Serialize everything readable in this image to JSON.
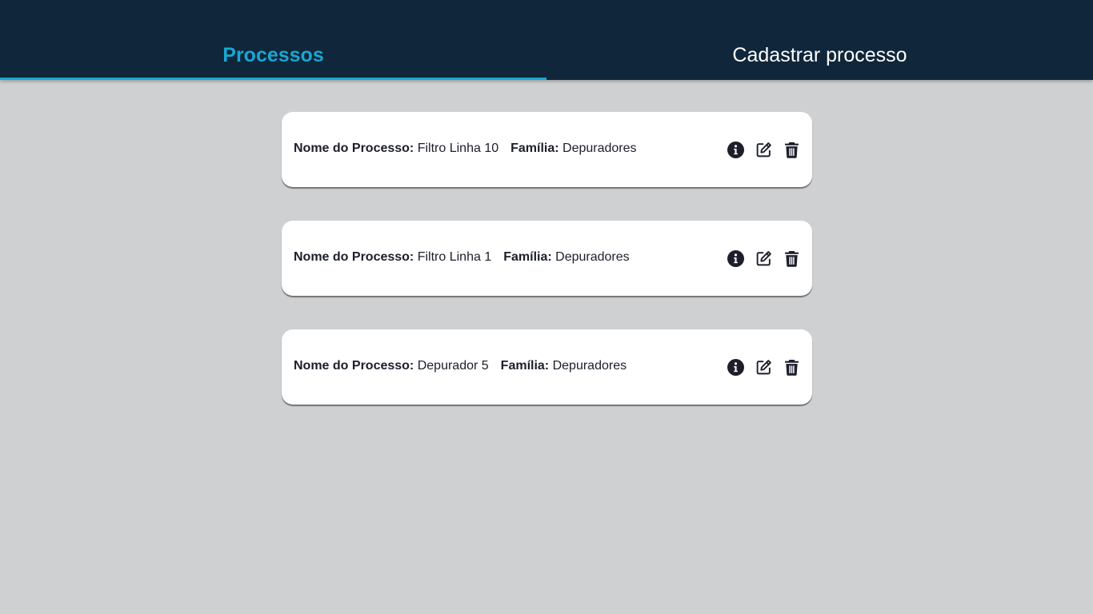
{
  "tabs": [
    {
      "label": "Processos",
      "active": true
    },
    {
      "label": "Cadastrar processo",
      "active": false
    }
  ],
  "labels": {
    "process_name": "Nome do Processo:",
    "family": "Família:"
  },
  "processes": [
    {
      "name": "Filtro Linha 10",
      "family": "Depuradores"
    },
    {
      "name": "Filtro Linha 1",
      "family": "Depuradores"
    },
    {
      "name": "Depurador 5",
      "family": "Depuradores"
    }
  ],
  "icons": [
    "info-icon",
    "edit-icon",
    "trash-icon"
  ],
  "colors": {
    "header_bg": "#10263a",
    "accent": "#1aa6d1",
    "page_bg": "#cfd0d2",
    "card_bg": "#ffffff",
    "text": "#1c1f2b"
  }
}
